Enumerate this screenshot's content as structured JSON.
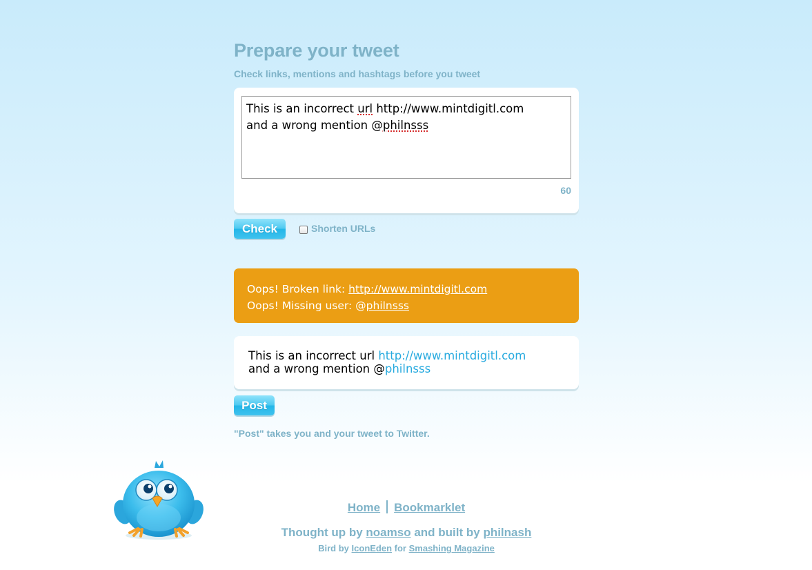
{
  "header": {
    "title": "Prepare your tweet",
    "subtitle": "Check links, mentions and hashtags before you tweet"
  },
  "compose": {
    "line1_pre": "This is an incorrect ",
    "line1_misspelled": "url",
    "line1_post": " http://www.mintdigitl.com",
    "line2_pre": "and a wrong mention @",
    "line2_misspelled": "philnsss",
    "char_count": "60"
  },
  "controls": {
    "check_label": "Check",
    "shorten_label": "Shorten URLs",
    "shorten_checked": false
  },
  "errors": {
    "broken_link_prefix": "Oops! Broken link: ",
    "broken_link_url": "http://www.mintdigitl.com",
    "missing_user_prefix": "Oops! Missing user: @",
    "missing_user": "philnsss"
  },
  "preview": {
    "text1": "This is an incorrect url ",
    "link": "http://www.mintdigitl.com",
    "text2": "and a wrong mention @",
    "mention": "philnsss"
  },
  "post": {
    "label": "Post",
    "note": "\"Post\" takes you and your tweet to Twitter."
  },
  "footer": {
    "nav_home": "Home",
    "nav_bookmarklet": "Bookmarklet",
    "thought_up_by": "Thought up by ",
    "author1": "noamso",
    "built_by": " and built by ",
    "author2": "philnash",
    "bird_by": "Bird by ",
    "icon_credit": "IconEden",
    "for_text": " for ",
    "magazine": "Smashing Magazine"
  },
  "colors": {
    "accent_text": "#7fb3c8",
    "error_bg": "#eb9e14",
    "link_blue": "#27aadf",
    "button_blue": "#3fc2ee"
  }
}
